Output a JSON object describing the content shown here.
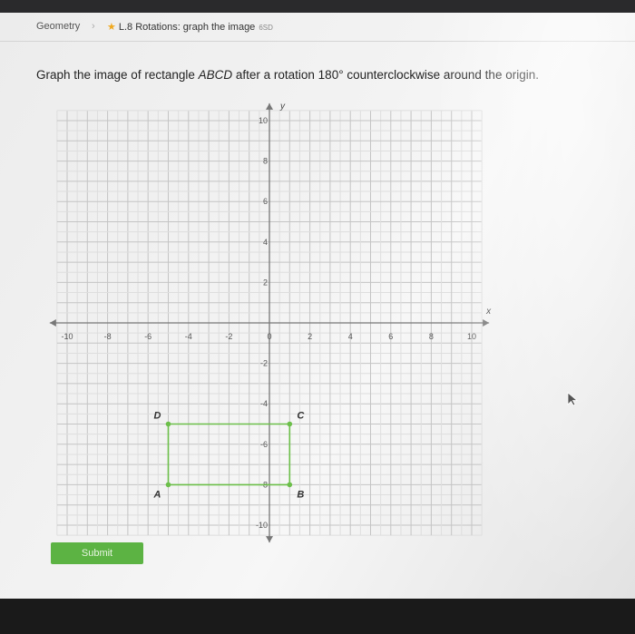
{
  "breadcrumb": {
    "subject": "Geometry",
    "separator": "›",
    "skill": "L.8 Rotations: graph the image",
    "skill_code": "6SD"
  },
  "question": {
    "prefix": "Graph the image of rectangle ",
    "shape": "ABCD",
    "suffix": " after a rotation 180° counterclockwise around the origin."
  },
  "graph": {
    "x_axis_label": "x",
    "y_axis_label": "y",
    "range": [
      -10,
      10
    ],
    "x_tick_labels": [
      "-10",
      "-8",
      "-6",
      "-4",
      "-2",
      "0",
      "2",
      "4",
      "6",
      "8",
      "10"
    ],
    "y_tick_labels": [
      "10",
      "8",
      "6",
      "4",
      "2",
      "-2",
      "-4",
      "-6",
      "-8",
      "-10"
    ],
    "rectangle_color": "#6cbf4a",
    "points": [
      {
        "label": "A",
        "x": -5,
        "y": -8
      },
      {
        "label": "B",
        "x": 1,
        "y": -8
      },
      {
        "label": "C",
        "x": 1,
        "y": -5
      },
      {
        "label": "D",
        "x": -5,
        "y": -5
      }
    ]
  },
  "submit_label": "Submit",
  "accent_color": "#5cb343"
}
